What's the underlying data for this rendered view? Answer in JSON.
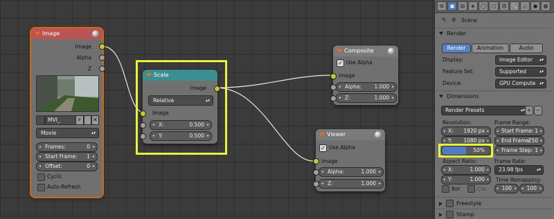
{
  "image_node": {
    "title": "Image",
    "outputs": [
      "Image",
      "Alpha",
      "Z"
    ],
    "filename": "MVI_",
    "f_label": "F",
    "source": "Movie",
    "frames_label": "Frames:",
    "frames_value": "0",
    "start_label": "Start Frame:",
    "start_value": "1",
    "offset_label": "Offset:",
    "offset_value": "0",
    "cyclic_label": "Cyclic",
    "autorefresh_label": "Auto-Refresh"
  },
  "scale_node": {
    "title": "Scale",
    "output": "Image",
    "mode": "Relative",
    "input": "Image",
    "x_label": "X:",
    "x_value": "0.500",
    "y_label": "Y:",
    "y_value": "0.500"
  },
  "composite_node": {
    "title": "Composite",
    "use_alpha": "Use Alpha",
    "input": "Image",
    "alpha_label": "Alpha:",
    "alpha_value": "1.000",
    "z_label": "Z:",
    "z_value": "1.000"
  },
  "viewer_node": {
    "title": "Viewer",
    "use_alpha": "Use Alpha",
    "input": "Image",
    "alpha_label": "Alpha:",
    "alpha_value": "1.000",
    "z_label": "Z:",
    "z_value": "1.000"
  },
  "panel": {
    "scene_label": "Scene",
    "render_section": "Render",
    "render_btn": "Render",
    "animation_btn": "Animation",
    "audio_btn": "Audio",
    "display_label": "Display:",
    "display_value": "Image Editor",
    "feature_label": "Feature Set:",
    "feature_value": "Supported",
    "device_label": "Device:",
    "device_value": "GPU Compute",
    "dimensions_section": "Dimensions",
    "presets": "Render Presets",
    "resolution_label": "Resolution:",
    "res_x_label": "X:",
    "res_x_value": "1920 px",
    "res_y_label": "Y:",
    "res_y_value": "1080 px",
    "res_pct": "50%",
    "frame_range_label": "Frame Range:",
    "start_frame_label": "Start Frame:",
    "start_frame_value": "1",
    "end_frame_label": "End Frame:",
    "end_frame_value": "250",
    "frame_step_label": "Frame Step:",
    "frame_step_value": "1",
    "aspect_label": "Aspect Ratio:",
    "asp_x_label": "X:",
    "asp_x_value": "1.000",
    "asp_y_label": "Y:",
    "asp_y_value": "1.000",
    "frame_rate_label": "Frame Rate:",
    "frame_rate_value": "23.98 fps",
    "time_remap_label": "Time Remapping:",
    "remap_old": "100",
    "remap_new": "100",
    "bor_label": "Bor",
    "cro_label": "Cro",
    "freestyle_section": "Freestyle",
    "stamp_section": "Stamp"
  },
  "colors": {
    "highlight": "#e8f53a",
    "input_header": "#bb5555",
    "distort_header": "#3b8e92",
    "socket_color": "#c8c834",
    "socket_gray": "#a1a1a1",
    "selected_button": "#5680c2"
  }
}
